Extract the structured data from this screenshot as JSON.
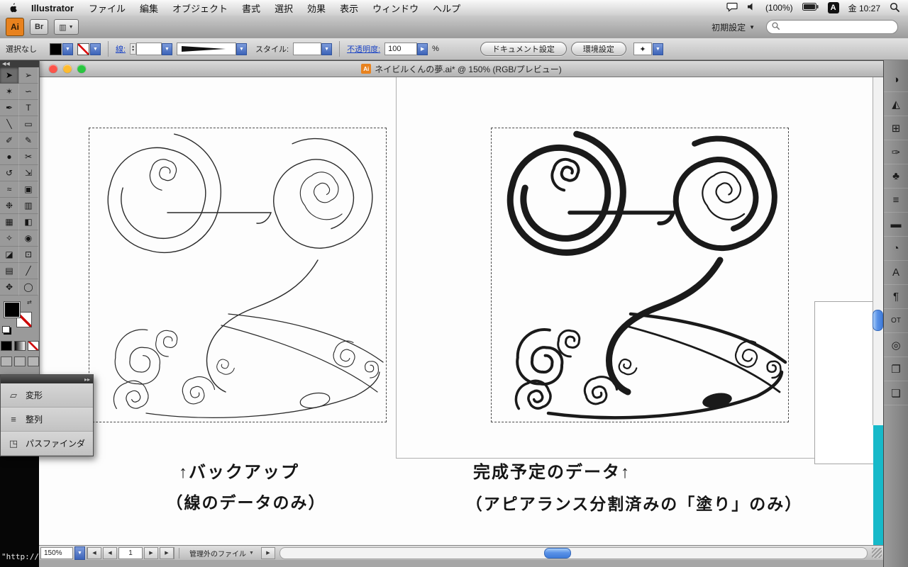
{
  "menu_bar": {
    "app_name": "Illustrator",
    "items": [
      "ファイル",
      "編集",
      "オブジェクト",
      "書式",
      "選択",
      "効果",
      "表示",
      "ウィンドウ",
      "ヘルプ"
    ],
    "battery_label": "(100%)",
    "input_indicator": "A",
    "clock": "金 10:27"
  },
  "app_bar": {
    "logo": "Ai",
    "bridge_label": "Br",
    "workspace_label": "初期設定",
    "search_value": ""
  },
  "control_bar": {
    "selection_status": "選択なし",
    "stroke_label": "線:",
    "style_label": "スタイル:",
    "opacity_label": "不透明度:",
    "opacity_value": "100",
    "percent_label": "%",
    "document_setup_label": "ドキュメント設定",
    "preferences_label": "環境設定"
  },
  "tools_panel": {
    "collapse_icon": "◀◀",
    "tools": [
      {
        "name": "selection-tool",
        "glyph": "➤",
        "selected": true
      },
      {
        "name": "direct-selection-tool",
        "glyph": "➢"
      },
      {
        "name": "magic-wand-tool",
        "glyph": "✶"
      },
      {
        "name": "lasso-tool",
        "glyph": "∽"
      },
      {
        "name": "pen-tool",
        "glyph": "✒"
      },
      {
        "name": "type-tool",
        "glyph": "T"
      },
      {
        "name": "line-segment-tool",
        "glyph": "╲"
      },
      {
        "name": "rectangle-tool",
        "glyph": "▭"
      },
      {
        "name": "paintbrush-tool",
        "glyph": "✐"
      },
      {
        "name": "pencil-tool",
        "glyph": "✎"
      },
      {
        "name": "blob-brush-tool",
        "glyph": "●"
      },
      {
        "name": "scissors-tool",
        "glyph": "✂"
      },
      {
        "name": "rotate-tool",
        "glyph": "↺"
      },
      {
        "name": "scale-tool",
        "glyph": "⇲"
      },
      {
        "name": "warp-tool",
        "glyph": "≈"
      },
      {
        "name": "free-transform-tool",
        "glyph": "▣"
      },
      {
        "name": "symbol-sprayer-tool",
        "glyph": "❉"
      },
      {
        "name": "graph-tool",
        "glyph": "▥"
      },
      {
        "name": "mesh-tool",
        "glyph": "▦"
      },
      {
        "name": "gradient-tool",
        "glyph": "◧"
      },
      {
        "name": "eyedropper-tool",
        "glyph": "✧"
      },
      {
        "name": "blend-tool",
        "glyph": "◉"
      },
      {
        "name": "live-paint-bucket-tool",
        "glyph": "◪"
      },
      {
        "name": "live-paint-selection-tool",
        "glyph": "⊡"
      },
      {
        "name": "crop-area-tool",
        "glyph": "▤"
      },
      {
        "name": "slice-tool",
        "glyph": "╱"
      },
      {
        "name": "hand-tool",
        "glyph": "✥"
      },
      {
        "name": "zoom-tool",
        "glyph": "◯"
      }
    ]
  },
  "floating_panel": {
    "collapse_icon": "▸▸",
    "items": [
      {
        "label": "変形",
        "glyph": "▱"
      },
      {
        "label": "整列",
        "glyph": "≡"
      },
      {
        "label": "パスファインダ",
        "glyph": "◳"
      }
    ]
  },
  "document_window": {
    "doc_icon": "Ai",
    "title": "ネイビルくんの夢.ai* @ 150% (RGB/プレビュー)"
  },
  "canvas": {
    "left_caption_line1": "↑バックアップ",
    "left_caption_line2": "（線のデータのみ）",
    "right_caption_line1": "完成予定のデータ↑",
    "right_caption_line2": "（アピアランス分割済みの「塗り」のみ）"
  },
  "status_bar": {
    "zoom": "150%",
    "page": "1",
    "status_text": "管理外のファイル"
  },
  "right_dock": {
    "icons": [
      {
        "name": "color-panel-icon",
        "glyph": "◑"
      },
      {
        "name": "color-guide-panel-icon",
        "glyph": "◭"
      },
      {
        "name": "swatches-panel-icon",
        "glyph": "⊞"
      },
      {
        "name": "brushes-panel-icon",
        "glyph": "✑"
      },
      {
        "name": "symbols-panel-icon",
        "glyph": "♣"
      },
      {
        "name": "align-panel-icon",
        "glyph": "≡"
      },
      {
        "name": "stroke-panel-icon",
        "glyph": "▬"
      },
      {
        "name": "transparency-panel-icon",
        "glyph": "◔"
      },
      {
        "name": "character-panel-icon",
        "glyph": "A"
      },
      {
        "name": "paragraph-panel-icon",
        "glyph": "¶"
      },
      {
        "name": "opentype-panel-icon",
        "glyph": "OT"
      },
      {
        "name": "attributes-panel-icon",
        "glyph": "◎"
      },
      {
        "name": "graphic-styles-panel-icon",
        "glyph": "❐"
      },
      {
        "name": "layers-panel-icon",
        "glyph": "❏"
      }
    ]
  },
  "desktop": {
    "terminal_text": "\"http://w"
  }
}
